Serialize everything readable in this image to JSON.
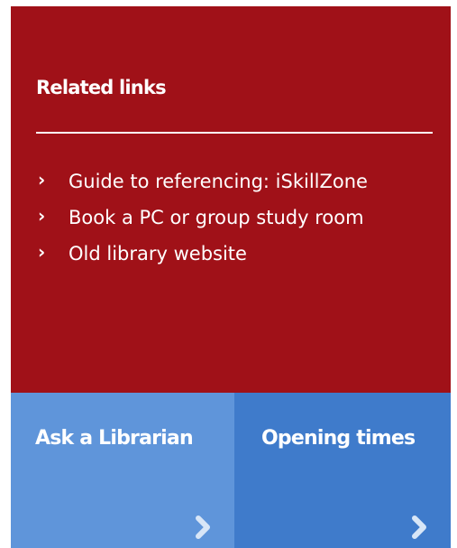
{
  "related": {
    "title": "Related links",
    "links": [
      {
        "label": "Guide to referencing: iSkillZone"
      },
      {
        "label": "Book a PC or group study room"
      },
      {
        "label": "Old library website"
      }
    ]
  },
  "tiles": [
    {
      "label": "Ask a Librarian",
      "icon": "chevron-right-icon"
    },
    {
      "label": "Opening times",
      "icon": "chevron-right-icon"
    }
  ],
  "colors": {
    "panel": "#a01118",
    "tile_ask": "#5f95da",
    "tile_open": "#3f7bcb"
  }
}
